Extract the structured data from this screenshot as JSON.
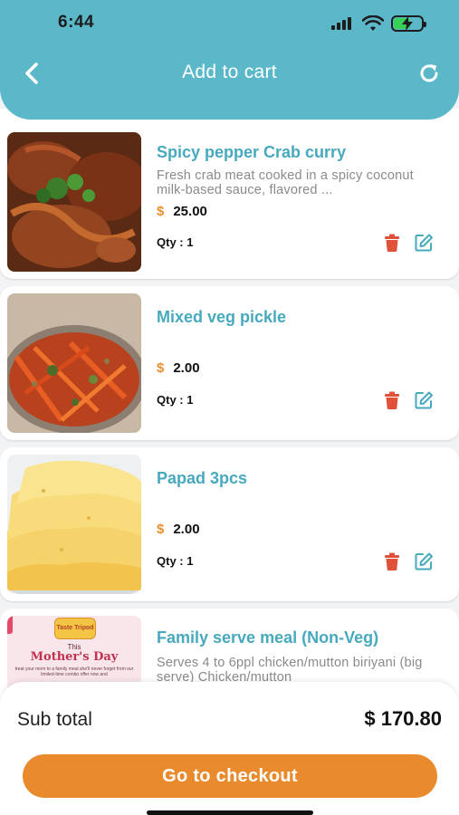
{
  "status_bar": {
    "time": "6:44"
  },
  "nav": {
    "title": "Add to cart",
    "back_icon": "chevron-left-icon",
    "refresh_icon": "refresh-icon"
  },
  "cart_items": [
    {
      "title": "Spicy pepper Crab curry",
      "description": "Fresh crab meat cooked in a spicy coconut milk-based sauce, flavored ...",
      "currency": "$",
      "price": "25.00",
      "qty_label": "Qty : 1",
      "image": "crab-curry-photo"
    },
    {
      "title": "Mixed veg pickle",
      "description": "",
      "currency": "$",
      "price": "2.00",
      "qty_label": "Qty : 1",
      "image": "veg-pickle-photo"
    },
    {
      "title": "Papad 3pcs",
      "description": "",
      "currency": "$",
      "price": "2.00",
      "qty_label": "Qty : 1",
      "image": "papad-photo"
    },
    {
      "title": "Family serve meal (Non-Veg)",
      "description": "Serves 4 to 6ppl chicken/mutton biriyani (big serve) Chicken/mutton",
      "image": "mothers-day-promo",
      "promo": {
        "title": "Mother's Day",
        "kicker": "This",
        "badge": "Taste Tripod",
        "fineprint": "treat your mom to a family meal she'll never forget from our limited-time combo offer now and"
      }
    }
  ],
  "summary": {
    "subtotal_label": "Sub total",
    "subtotal_value": "$ 170.80",
    "checkout_label": "Go to checkout"
  },
  "colors": {
    "header": "#5bb8c9",
    "title": "#47a9bd",
    "accent": "#e98a2c",
    "delete": "#e0513a"
  }
}
